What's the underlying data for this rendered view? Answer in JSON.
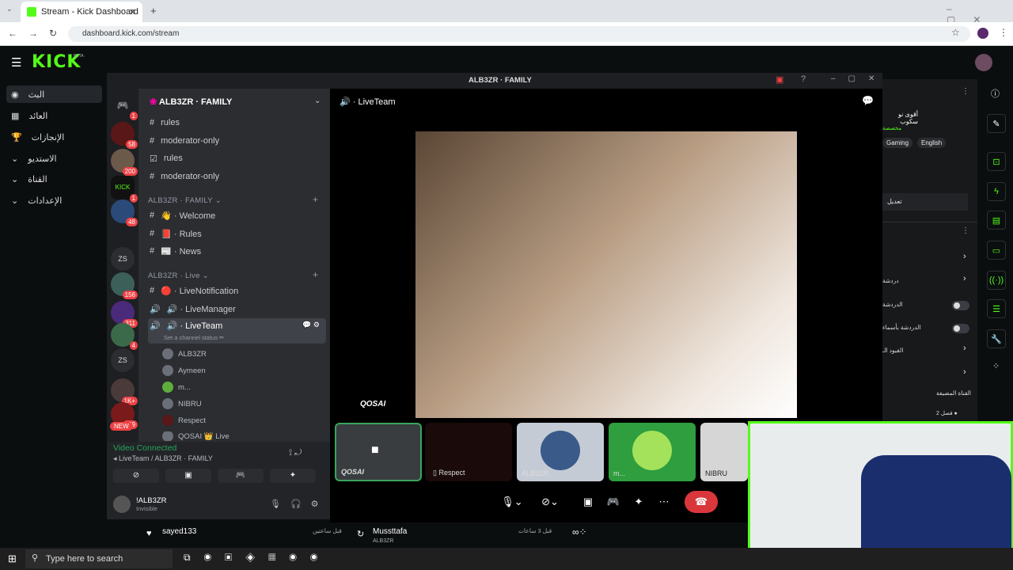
{
  "browser": {
    "tab_title": "Stream - Kick Dashboard",
    "url": "dashboard.kick.com/stream"
  },
  "kick": {
    "logo": "KICK",
    "beta": "BETA",
    "window_title": "ALB3ZR · FAMILY",
    "sidebar": [
      {
        "label": "البث",
        "icon": "broadcast-icon"
      },
      {
        "label": "العائد",
        "icon": "home-icon"
      },
      {
        "label": "الإنجازات",
        "icon": "trophy-icon"
      },
      {
        "label": "الاستديو",
        "icon": "chevron-down-icon"
      },
      {
        "label": "القناة",
        "icon": "chevron-down-icon"
      },
      {
        "label": "الإعدادات",
        "icon": "chevron-down-icon"
      }
    ]
  },
  "servers": [
    {
      "badge": "1"
    },
    {
      "badge": "58"
    },
    {
      "badge": "200"
    },
    {
      "badge": "1"
    },
    {
      "badge": "48"
    },
    {
      "label": "ZS"
    },
    {
      "badge": "156"
    },
    {
      "badge": "311"
    },
    {
      "badge": "4"
    },
    {
      "label": "ZS"
    },
    {
      "badge": "1K+"
    },
    {
      "badge": "129"
    },
    {
      "label": "NEW"
    }
  ],
  "server_name": "ALB3ZR · FAMILY",
  "channels": {
    "top": [
      "rules",
      "moderator-only",
      "rules",
      "moderator-only"
    ],
    "cat1": "ALB3ZR · FAMILY ⌄",
    "family": [
      "👋 · Welcome",
      "📕 · Rules",
      "📰 · News"
    ],
    "cat2": "ALB3ZR · Live ⌄",
    "live": [
      "🔴 · LiveNotification",
      "🔊 · LiveManager"
    ],
    "selected": "🔊 · LiveTeam",
    "status": "Set a channel status ✏",
    "users": [
      "ALB3ZR",
      "Aymeen",
      "m...",
      "NIBRU",
      "Respect",
      "QOSAI 👑 Live"
    ]
  },
  "voice": {
    "status": "Video Connected",
    "channel": "LiveTeam / ALB3ZR · FAMILY",
    "user": "!ALB3ZR",
    "user_status": "Invisible"
  },
  "video": {
    "header": "🔊 · LiveTeam",
    "name": "QOSAI",
    "tiles": [
      {
        "label": "QOSAI"
      },
      {
        "label": "Respect"
      },
      {
        "label": "ALB3ZR"
      },
      {
        "label": "m..."
      },
      {
        "label": "NIBRU"
      }
    ]
  },
  "right": {
    "t1": "أقوى نو سكوب",
    "t2": "مخصصة",
    "tags": [
      "Gaming",
      "English"
    ],
    "edit": "تعديل",
    "rows": [
      "دردشة",
      "الدردشة",
      "الدردشة بأسماء",
      "القيود الـ"
    ],
    "section": "القناة المضيفة",
    "count": "فصل 2 ●"
  },
  "chat": [
    {
      "user": "sayed133",
      "time": "قبل ساعتين"
    },
    {
      "user": "Mussttafa",
      "time": "قبل 3 ساعات",
      "sub": "ALB3ZR"
    }
  ],
  "taskbar": {
    "search": "Type here to search"
  }
}
